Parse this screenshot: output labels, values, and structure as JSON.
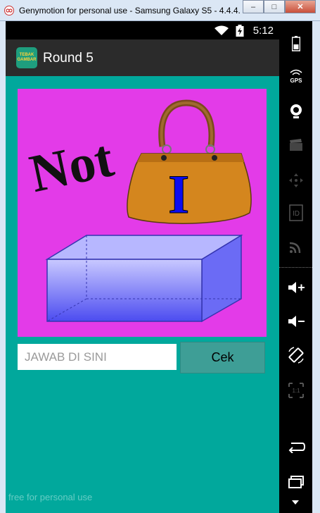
{
  "window": {
    "title": "Genymotion for personal use - Samsung Galaxy S5 - 4.4.4...",
    "minimize_glyph": "–",
    "maximize_glyph": "□",
    "close_glyph": "✕"
  },
  "statusbar": {
    "time": "5:12"
  },
  "actionbar": {
    "logo_top": "TEBAK",
    "logo_bottom": "GAMBAR",
    "title": "Round 5"
  },
  "puzzle": {
    "word": "Not",
    "letter": "I"
  },
  "answer": {
    "placeholder": "JAWAB DI SINI",
    "value": ""
  },
  "check_button": {
    "label": "Cek"
  },
  "watermark": "free for personal use",
  "sidebar": {
    "items": [
      {
        "name": "battery-icon"
      },
      {
        "name": "gps-icon",
        "label": "GPS"
      },
      {
        "name": "webcam-icon"
      },
      {
        "name": "video-capture-icon"
      },
      {
        "name": "remote-control-icon"
      },
      {
        "name": "id-icon",
        "label": "ID"
      },
      {
        "name": "cast-icon"
      },
      {
        "name": "volume-up-icon"
      },
      {
        "name": "volume-down-icon"
      },
      {
        "name": "rotate-icon"
      },
      {
        "name": "pixel-perfect-icon",
        "label": "1:1"
      },
      {
        "name": "back-icon"
      },
      {
        "name": "recent-apps-icon"
      }
    ]
  },
  "colors": {
    "content_bg": "#01a89c",
    "puzzle_bg": "#e33be8",
    "actionbar": "#2b2b2b",
    "button": "#3e9e96"
  }
}
